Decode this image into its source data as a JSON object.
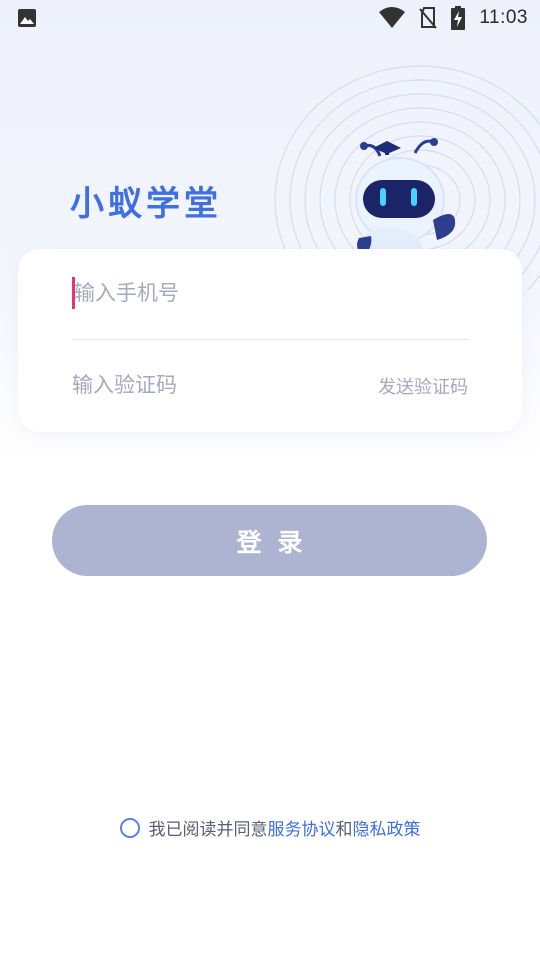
{
  "status_bar": {
    "time": "11:03",
    "left_icon": "image-icon",
    "icons": [
      "wifi-icon",
      "no-sim-icon",
      "battery-charging-icon"
    ]
  },
  "brand": {
    "title": "小蚁学堂",
    "mascot": "robot-ant-mascot",
    "color": "#3f6fe0"
  },
  "form": {
    "phone_placeholder": "输入手机号",
    "phone_value": "",
    "code_placeholder": "输入验证码",
    "code_value": "",
    "send_code_label": "发送验证码"
  },
  "login": {
    "label": "登录",
    "bg_color": "#adb4d1"
  },
  "agreement": {
    "prefix": "我已阅读并同意",
    "terms_label": "服务协议",
    "and": "和",
    "privacy_label": "隐私政策",
    "checked": false,
    "link_color": "#3f6fe0"
  }
}
